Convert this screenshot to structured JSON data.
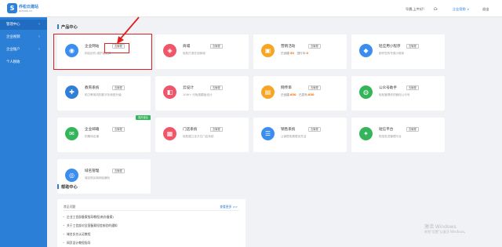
{
  "brand": {
    "name": "乔松云建站",
    "sub": "qiaoqk.cn",
    "logo_letter": "S",
    "color": "#2f7fd8"
  },
  "topbar": {
    "greeting": "早晨,上午好!",
    "org_link": "企业视角 ∨",
    "exit": "退出"
  },
  "sidebar": {
    "items": [
      {
        "label": "管理中心",
        "chev": "‹"
      },
      {
        "label": "企业视频",
        "chev": "›"
      },
      {
        "label": "企业账户",
        "chev": "›"
      },
      {
        "label": "个人税收",
        "chev": ""
      }
    ],
    "color": "#2c7fd6",
    "active_color": "#1f6cc0"
  },
  "products": {
    "title": "产品中心",
    "cards": [
      {
        "name": "企业网站",
        "tag": "去管理",
        "desc": "网站创作,维护能选择",
        "icon": "globe-icon",
        "glyph": "◉",
        "color": "#3b8ef0"
      },
      {
        "name": "商城",
        "tag": "去管理",
        "desc": "轻松打造在线商城",
        "icon": "bag-icon",
        "glyph": "◈",
        "color": "#f0566a"
      },
      {
        "name": "营销活动",
        "tag": "去管理",
        "kv1": "已创建:",
        "num1": "50",
        "kv2": "进行中:",
        "num2": "0",
        "icon": "gift-icon",
        "glyph": "▣",
        "color": "#f7a623"
      },
      {
        "name": "轻应用小程序",
        "tag": "去管理",
        "desc": "制作您的专属小程序",
        "icon": "miniapp-icon",
        "glyph": "◆",
        "color": "#3b8ef0"
      },
      {
        "name": "教育系统",
        "tag": "去管理",
        "desc": "助力教育机构数字化转型升级",
        "icon": "education-icon",
        "glyph": "✚",
        "color": "#2f7fd8"
      },
      {
        "name": "云设计",
        "tag": "去管理",
        "desc": "10W+ 可免费模板设计",
        "icon": "design-icon",
        "glyph": "◧",
        "color": "#f0566a"
      },
      {
        "name": "网传单",
        "tag": "去管理",
        "kv1": "已创建:",
        "num1": "850",
        "kv2": "已发布:",
        "num2": "850",
        "icon": "flyer-icon",
        "glyph": "▤",
        "color": "#f7a623"
      },
      {
        "name": "公众号助手",
        "tag": "去管理",
        "desc": "轻松管理你的微信公众号",
        "icon": "wechat-icon",
        "glyph": "◍",
        "color": "#35b55a"
      },
      {
        "name": "企业邮箱",
        "tag": "去管理",
        "desc": "别期待店铺",
        "icon": "mail-icon",
        "glyph": "✉",
        "color": "#35b55a",
        "ribbon": "提升营业"
      },
      {
        "name": "门店系统",
        "tag": "去管理",
        "desc": "轻松建立全方位门店系统",
        "icon": "store-icon",
        "glyph": "▦",
        "color": "#f0566a"
      },
      {
        "name": "销售系统",
        "tag": "去管理",
        "desc": "让销售拓展更加灵活",
        "icon": "sales-icon",
        "glyph": "☰",
        "color": "#3b8ef0"
      },
      {
        "name": "短信平台",
        "tag": "去管理",
        "desc": "短信发送管理平台",
        "icon": "sms-icon",
        "glyph": "✦",
        "color": "#35b55a"
      },
      {
        "name": "域名管理",
        "tag": "去管理",
        "desc": "域名购买和网站解析",
        "icon": "domain-icon",
        "glyph": "◎",
        "color": "#3b8ef0"
      }
    ]
  },
  "help": {
    "title": "帮助中心",
    "head": "常见问题",
    "more": "查看更多 >>",
    "items": [
      "企业工信部备案指导教程(新办备案)",
      "关于工信部对全国备案短信核验的通知",
      "域名实名认证教程",
      "网页设计教程指导"
    ]
  },
  "watermark": {
    "line1": "激活 Windows",
    "line2": "转到\"设置\"以激活 Windows。"
  },
  "annotation_color": "#e02020"
}
